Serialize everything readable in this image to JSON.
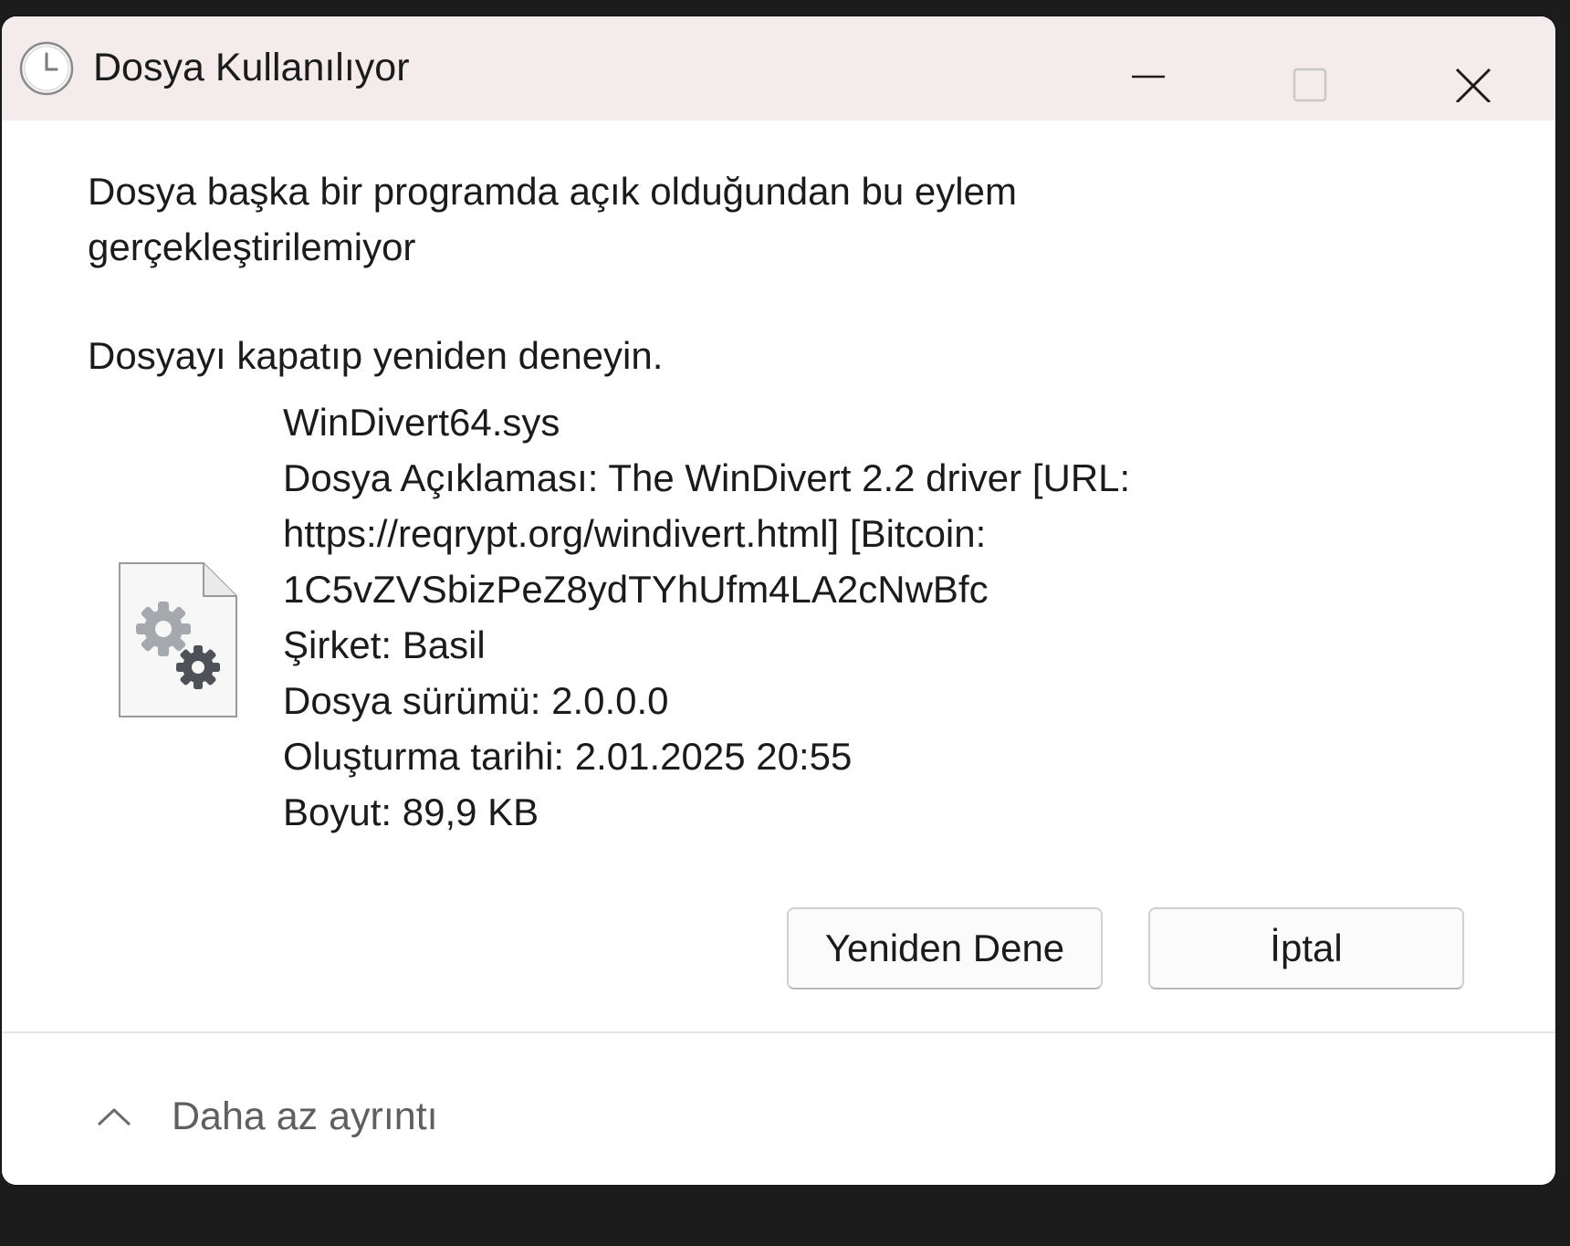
{
  "window": {
    "title": "Dosya Kullanılıyor",
    "icon": "clock-icon",
    "controls": {
      "minimize_icon": "minimize-icon",
      "maximize_icon": "maximize-icon",
      "close_icon": "close-icon"
    }
  },
  "message": {
    "line1": "Dosya başka bir programda açık olduğundan bu eylem",
    "line2": "gerçekleştirilemiyor",
    "hint": "Dosyayı kapatıp yeniden deneyin."
  },
  "file": {
    "icon": "system-file-gear-icon",
    "name": "WinDivert64.sys",
    "description_line1": "Dosya Açıklaması: The WinDivert 2.2 driver [URL:",
    "description_line2": "https://reqrypt.org/windivert.html] [Bitcoin:",
    "description_line3": "1C5vZVSbizPeZ8ydTYhUfm4LA2cNwBfc",
    "company": "Şirket: Basil",
    "version": "Dosya sürümü: 2.0.0.0",
    "created": "Oluşturma tarihi: 2.01.2025 20:55",
    "size": "Boyut: 89,9 KB"
  },
  "buttons": {
    "retry": "Yeniden Dene",
    "cancel": "İptal"
  },
  "footer": {
    "toggle_icon": "chevron-up-icon",
    "toggle_label": "Daha az ayrıntı"
  },
  "colors": {
    "titlebar_bg": "#f4ecec",
    "dialog_bg": "#ffffff",
    "backdrop": "#1c1c1c",
    "text": "#1b1b1b",
    "muted_text": "#5f5f5f"
  }
}
